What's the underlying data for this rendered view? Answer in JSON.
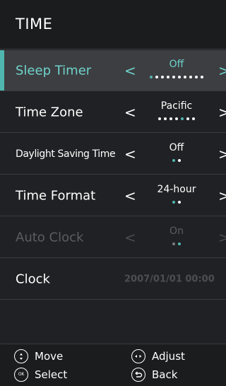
{
  "header": {
    "title": "TIME"
  },
  "rows": [
    {
      "label": "Sleep Timer",
      "value": "Off",
      "dot_count": 10,
      "active_dot": 0
    },
    {
      "label": "Time Zone",
      "value": "Pacific",
      "dot_count": 7,
      "active_dot": 4
    },
    {
      "label": "Daylight Saving Time",
      "value": "Off",
      "dot_count": 2,
      "active_dot": 0
    },
    {
      "label": "Time Format",
      "value": "24-hour",
      "dot_count": 2,
      "active_dot": 0
    },
    {
      "label": "Auto Clock",
      "value": "On",
      "dot_count": 2,
      "active_dot": 1
    },
    {
      "label": "Clock",
      "value": "2007/01/01 00:00"
    }
  ],
  "arrows": {
    "left": "<",
    "right": ">"
  },
  "footer": {
    "move": "Move",
    "adjust": "Adjust",
    "select": "Select",
    "back": "Back",
    "ok_icon_text": "OK"
  },
  "colors": {
    "accent": "#4fb7b0",
    "background": "#202124",
    "disabled": "#5c5d60"
  }
}
